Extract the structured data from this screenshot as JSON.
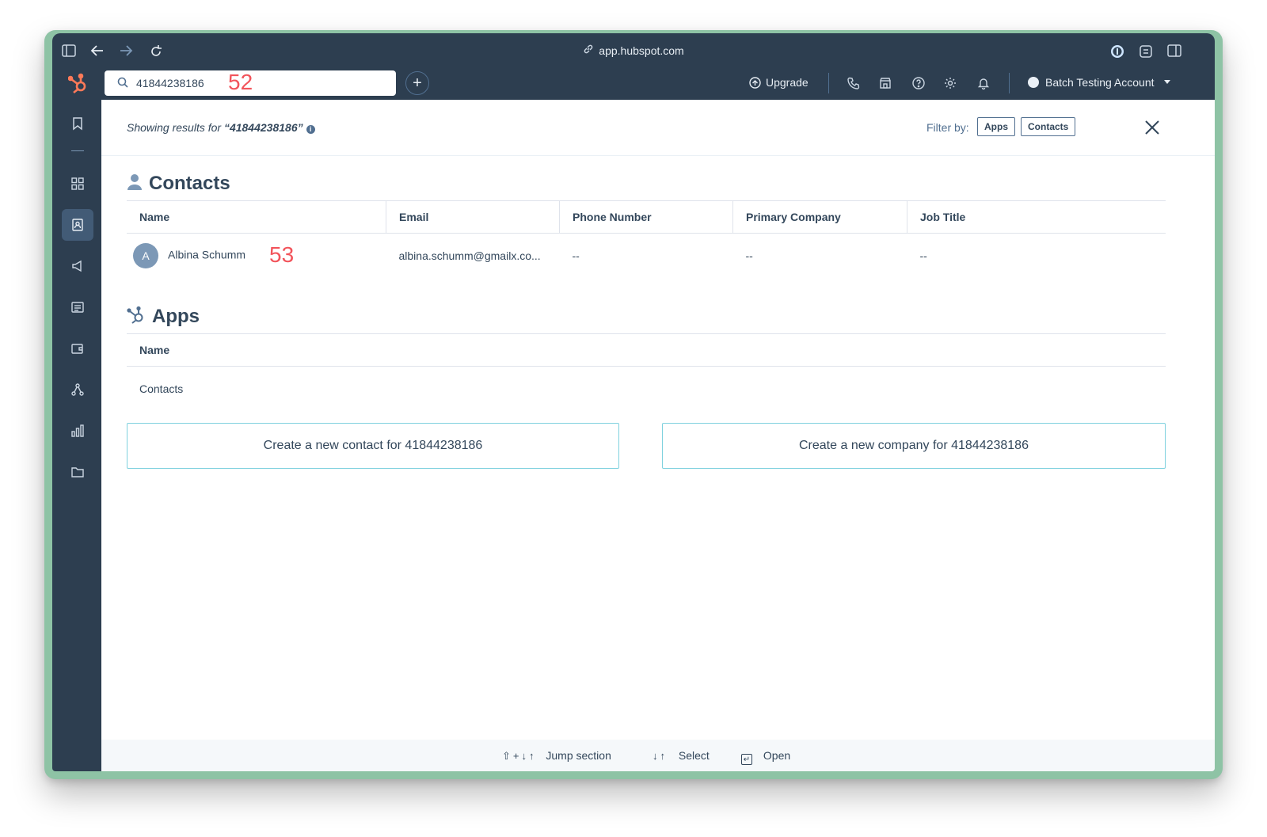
{
  "browser": {
    "url": "app.hubspot.com"
  },
  "header": {
    "search_value": "41844238186",
    "search_annotation": "52",
    "add_label": "+",
    "upgrade_label": "Upgrade",
    "account_name": "Batch Testing Account"
  },
  "results": {
    "showing_prefix": "Showing results for",
    "query_quoted": "“41844238186”",
    "filter_label": "Filter by:",
    "filter_options": [
      "Apps",
      "Contacts"
    ]
  },
  "contacts": {
    "title": "Contacts",
    "columns": [
      "Name",
      "Email",
      "Phone Number",
      "Primary Company",
      "Job Title"
    ],
    "rows": [
      {
        "avatar_initial": "A",
        "name": "Albina Schumm",
        "annotation": "53",
        "email": "albina.schumm@gmailx.co...",
        "phone": "--",
        "company": "--",
        "job_title": "--"
      }
    ]
  },
  "apps": {
    "title": "Apps",
    "columns": [
      "Name"
    ],
    "rows": [
      {
        "name": "Contacts"
      }
    ]
  },
  "actions": {
    "create_contact": "Create a new contact for 41844238186",
    "create_company": "Create a new company for 41844238186"
  },
  "footer": {
    "jump_keys": "⇧+↓↑",
    "jump_label": "Jump section",
    "select_keys": "↓↑",
    "select_label": "Select",
    "open_label": "Open"
  },
  "colors": {
    "nav_bg": "#2d3e50",
    "brand_orange": "#ff7a59",
    "annotation_red": "#f2545b",
    "button_border": "#7fd1de"
  }
}
